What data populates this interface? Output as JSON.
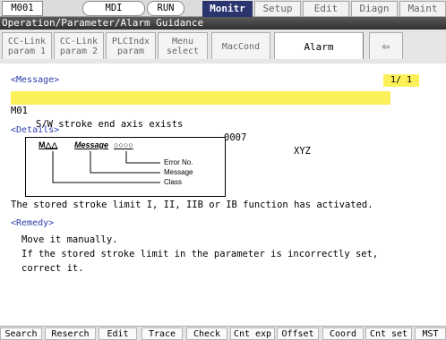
{
  "topbar": {
    "screen_id": "M001",
    "mode": "MDI",
    "run_state": "RUN",
    "tabs": [
      "Monitr",
      "Setup",
      "Edit",
      "Diagn",
      "Maint"
    ]
  },
  "title": "Operation/Parameter/Alarm Guidance",
  "param_tabs": [
    {
      "label": "CC-Link param 1"
    },
    {
      "label": "CC-Link param 2"
    },
    {
      "label": "PLCIndx param"
    },
    {
      "label": "Menu select"
    },
    {
      "label": "MacCond"
    },
    {
      "label": "Alarm"
    }
  ],
  "message_section": {
    "title": "<Message>",
    "page": "1/ 1",
    "code": "M01",
    "text": "S/W stroke end axis exists",
    "number": "0007",
    "axes": "XYZ"
  },
  "details_section": {
    "title": "<Details>",
    "diagram": {
      "class_symbol": "M△△",
      "message_word": "Message",
      "error_no_symbol": "○○○○",
      "label_error_no": "Error No.",
      "label_message": "Message",
      "label_class": "Class"
    },
    "description": "The stored stroke limit I, II, IIB or IB function has activated."
  },
  "remedy_section": {
    "title": "<Remedy>",
    "lines": [
      "Move it manually.",
      "If the stored stroke limit in the parameter is incorrectly set,",
      "correct it."
    ]
  },
  "function_keys": [
    "Search",
    "Reserch",
    "Edit",
    "Trace",
    "Check",
    "Cnt exp",
    "Offset",
    "Coord",
    "Cnt set",
    "MST"
  ],
  "colors": {
    "highlight": "#fcf05a",
    "section_title": "#2c3dab",
    "active_tab": "#2a3570"
  }
}
